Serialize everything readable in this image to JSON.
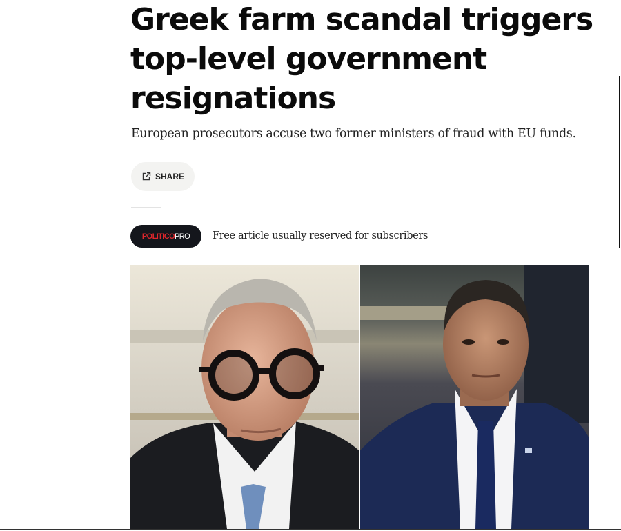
{
  "article": {
    "headline": "Greek farm scandal triggers top-level government resignations",
    "subheadline": "European prosecutors accuse two former ministers of fraud with EU funds.",
    "share_label": "SHARE",
    "badge": {
      "brand": "POLITICO",
      "tier": "PRO"
    },
    "free_note": "Free article usually reserved for subscribers"
  },
  "icons": {
    "share": "external-share-icon"
  },
  "colors": {
    "badge_bg": "#14161c",
    "badge_brand": "#e0262c",
    "share_bg": "#f3f3f1"
  }
}
